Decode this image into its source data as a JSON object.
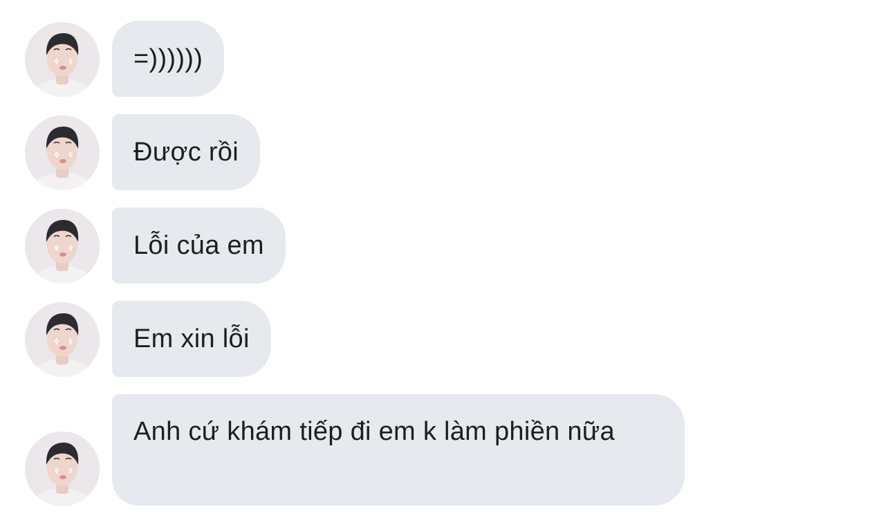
{
  "colors": {
    "bubble_bg": "#e6e9ee",
    "text": "#1c1e21",
    "page_bg": "#ffffff"
  },
  "messages": [
    {
      "text": "=))))))",
      "sender": "other",
      "avatar_icon": "user-avatar-icon"
    },
    {
      "text": "Được rồi",
      "sender": "other",
      "avatar_icon": "user-avatar-icon"
    },
    {
      "text": "Lỗi của em",
      "sender": "other",
      "avatar_icon": "user-avatar-icon"
    },
    {
      "text": "Em xin lỗi",
      "sender": "other",
      "avatar_icon": "user-avatar-icon"
    },
    {
      "text": "Anh cứ khám tiếp đi em k làm phiền nữa",
      "sender": "other",
      "avatar_icon": "user-avatar-icon"
    }
  ]
}
